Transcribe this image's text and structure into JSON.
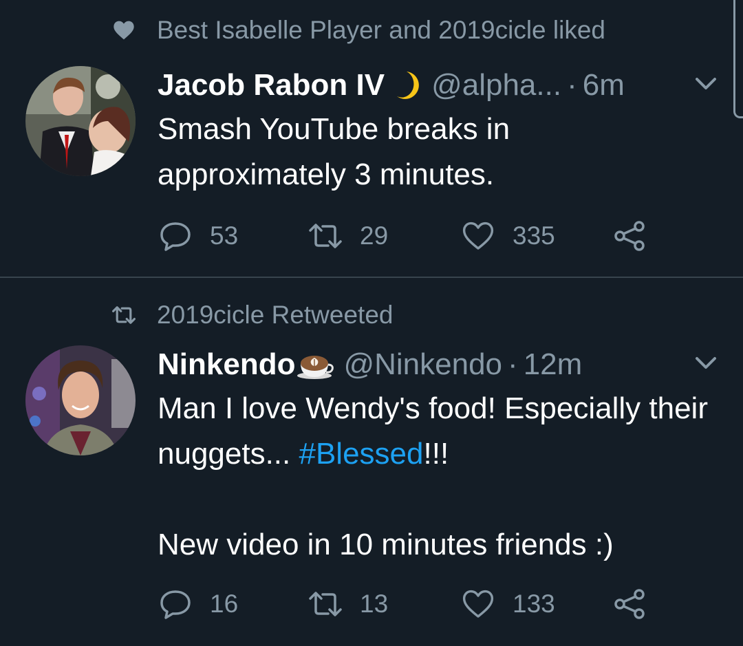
{
  "colors": {
    "background": "#141d26",
    "secondary_text": "#8899a6",
    "divider": "#38444d",
    "hashtag": "#1da1f2"
  },
  "tweets": [
    {
      "social_context": "Best Isabelle Player and 2019cicle liked",
      "social_icon": "heart-icon",
      "display_name": "Jacob Rabon IV",
      "name_emoji": "crescent-moon",
      "handle": "@alpha...",
      "separator": "·",
      "time": "6m",
      "text_lines": [
        "Smash YouTube breaks in",
        "approximately 3 minutes."
      ],
      "replies": "53",
      "retweets": "29",
      "likes": "335"
    },
    {
      "social_context": "2019cicle Retweeted",
      "social_icon": "retweet-icon",
      "display_name": "Ninkendo",
      "name_emoji": "latte-art-cup",
      "handle": "@Ninkendo",
      "separator": "·",
      "time": "12m",
      "text_pre": "Man I love Wendy's food! Especially their nuggets... ",
      "hashtag": "#Blessed",
      "text_post": "!!!",
      "text_line2": "New video in 10 minutes friends :)",
      "replies": "16",
      "retweets": "13",
      "likes": "133"
    }
  ]
}
